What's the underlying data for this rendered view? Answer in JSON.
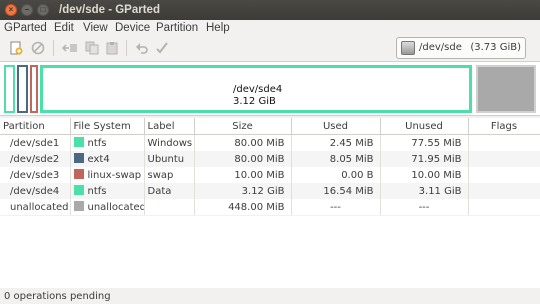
{
  "window": {
    "title": "/dev/sde - GParted"
  },
  "menu": [
    "GParted",
    "Edit",
    "View",
    "Device",
    "Partition",
    "Help"
  ],
  "toolbar": {
    "icons": [
      "new-icon",
      "delete-icon",
      "resize-move-icon",
      "copy-icon",
      "paste-icon",
      "undo-icon",
      "apply-icon"
    ]
  },
  "device": {
    "name": "/dev/sde",
    "size": "(3.73 GiB)"
  },
  "graph": {
    "partitions": [
      {
        "name": "/dev/sde1",
        "color": "#4ce0a8"
      },
      {
        "name": "/dev/sde2",
        "color": "#4b6983"
      },
      {
        "name": "/dev/sde3",
        "color": "#c1665a"
      },
      {
        "name": "/dev/sde4",
        "size": "3.12 GiB",
        "color": "#4ce0a8"
      }
    ],
    "unallocated_color": "#a9a9a9"
  },
  "table": {
    "headers": [
      "Partition",
      "File System",
      "Label",
      "Size",
      "Used",
      "Unused",
      "Flags"
    ],
    "rows": [
      {
        "partition": "/dev/sde1",
        "fs": "ntfs",
        "fs_color": "#4ce0a8",
        "label": "Windows",
        "size": "80.00 MiB",
        "used": "2.45 MiB",
        "unused": "77.55 MiB",
        "flags": ""
      },
      {
        "partition": "/dev/sde2",
        "fs": "ext4",
        "fs_color": "#4b6983",
        "label": "Ubuntu",
        "size": "80.00 MiB",
        "used": "8.05 MiB",
        "unused": "71.95 MiB",
        "flags": ""
      },
      {
        "partition": "/dev/sde3",
        "fs": "linux-swap",
        "fs_color": "#c1665a",
        "label": "swap",
        "size": "10.00 MiB",
        "used": "0.00 B",
        "unused": "10.00 MiB",
        "flags": ""
      },
      {
        "partition": "/dev/sde4",
        "fs": "ntfs",
        "fs_color": "#4ce0a8",
        "label": "Data",
        "size": "3.12 GiB",
        "used": "16.54 MiB",
        "unused": "3.11 GiB",
        "flags": ""
      },
      {
        "partition": "unallocated",
        "fs": "unallocated",
        "fs_color": "#a9a9a9",
        "label": "",
        "size": "448.00 MiB",
        "used": "---",
        "unused": "---",
        "flags": ""
      }
    ]
  },
  "status": "0 operations pending"
}
